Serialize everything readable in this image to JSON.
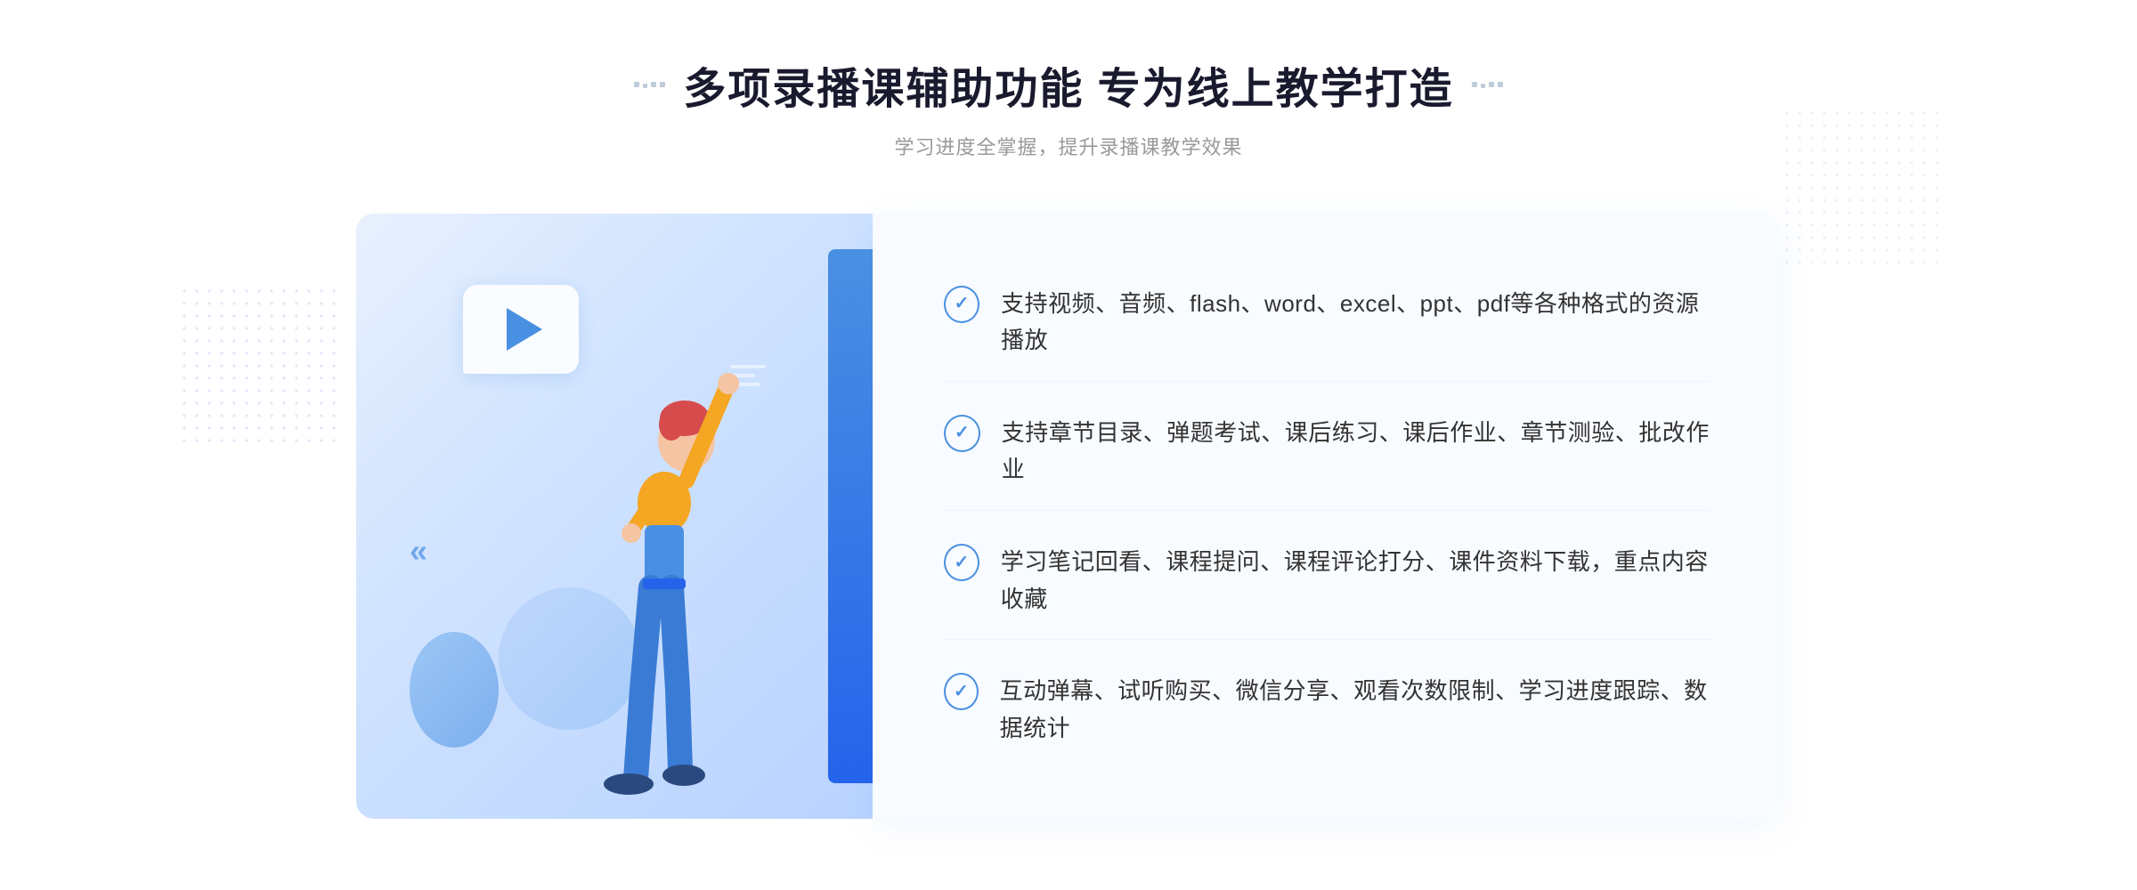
{
  "header": {
    "title": "多项录播课辅助功能 专为线上教学打造",
    "subtitle": "学习进度全掌握，提升录播课教学效果"
  },
  "features": [
    {
      "id": "feature-1",
      "text": "支持视频、音频、flash、word、excel、ppt、pdf等各种格式的资源播放"
    },
    {
      "id": "feature-2",
      "text": "支持章节目录、弹题考试、课后练习、课后作业、章节测验、批改作业"
    },
    {
      "id": "feature-3",
      "text": "学习笔记回看、课程提问、课程评论打分、课件资料下载，重点内容收藏"
    },
    {
      "id": "feature-4",
      "text": "互动弹幕、试听购买、微信分享、观看次数限制、学习进度跟踪、数据统计"
    }
  ],
  "deco": {
    "chevron": "»",
    "chevron_left": "«"
  }
}
